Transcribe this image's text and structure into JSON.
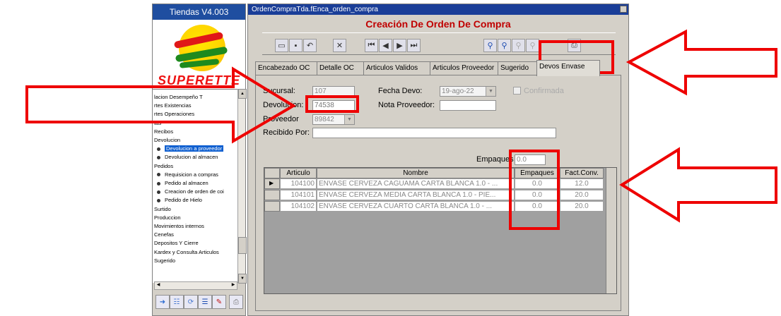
{
  "left_panel": {
    "title": "Tiendas V4.003",
    "logo_text": "SUPERETTE",
    "nav_items": [
      {
        "label": "lacion Desempeño T",
        "level": 0
      },
      {
        "label": "rtes Existencias",
        "level": 0
      },
      {
        "label": "rtes Operaciones",
        "level": 0
      },
      {
        "label": "tas",
        "level": 0
      },
      {
        "label": "Recibos",
        "level": 0
      },
      {
        "label": "Devolucion",
        "level": 0
      },
      {
        "label": "Devolucion a proveedor",
        "level": 1,
        "selected": true
      },
      {
        "label": "Devolucion al almacen",
        "level": 1
      },
      {
        "label": "Pedidos",
        "level": 0
      },
      {
        "label": "Requisicion a compras",
        "level": 1
      },
      {
        "label": "Pedido al almacen",
        "level": 1
      },
      {
        "label": "Creacion de orden de coi",
        "level": 1
      },
      {
        "label": "Pedido de Hielo",
        "level": 1
      },
      {
        "label": "Surtido",
        "level": 0
      },
      {
        "label": "Produccion",
        "level": 0
      },
      {
        "label": "Movimientos internos",
        "level": 0
      },
      {
        "label": "Cenefas",
        "level": 0
      },
      {
        "label": "Depositos Y Cierre",
        "level": 0
      },
      {
        "label": "Kardex y Consulta Articulos",
        "level": 0
      },
      {
        "label": "Sugerido",
        "level": 0
      }
    ]
  },
  "window": {
    "title": "OrdenCompraTda.fEnca_orden_compra",
    "form_title": "Creación De Orden De Compra"
  },
  "tabs": [
    "Encabezado OC",
    "Detalle OC",
    "Articulos Validos",
    "Articulos Proveedor",
    "Sugerido",
    "Devos Envase"
  ],
  "active_tab": "Devos Envase",
  "form": {
    "sucursal_label": "Sucursal:",
    "sucursal_value": "107",
    "devolucion_label": "Devolucion:",
    "devolucion_value": "74538",
    "proveedor_label": "Proveedor",
    "proveedor_value": "89842",
    "recibido_label": "Recibido Por:",
    "recibido_value": "",
    "fecha_label": "Fecha Devo:",
    "fecha_value": "19-ago-22",
    "nota_label": "Nota Proveedor:",
    "nota_value": "",
    "confirmada_label": "Confirmada",
    "empaques_label": "Empaques",
    "empaques_value": "0.0"
  },
  "grid": {
    "headers": [
      "Articulo",
      "Nombre",
      "Empaques",
      "Fact.Conv."
    ],
    "rows": [
      {
        "articulo": "104100",
        "nombre": "ENVASE  CERVEZA CAGUAMA  CARTA BLANCA  1.0 - ...",
        "empaques": "0.0",
        "fact": "12.0"
      },
      {
        "articulo": "104101",
        "nombre": "ENVASE  CERVEZA MEDIA  CARTA BLANCA  1.0 - PIE...",
        "empaques": "0.0",
        "fact": "20.0"
      },
      {
        "articulo": "104102",
        "nombre": "ENVASE  CERVEZA CUARTO  CARTA BLANCA  1.0 - ...",
        "empaques": "0.0",
        "fact": "20.0"
      }
    ]
  },
  "colors": {
    "annotation": "#ee0000",
    "titlebar": "#1a3e98",
    "form_title": "#c00000",
    "selection": "#1060d0"
  }
}
